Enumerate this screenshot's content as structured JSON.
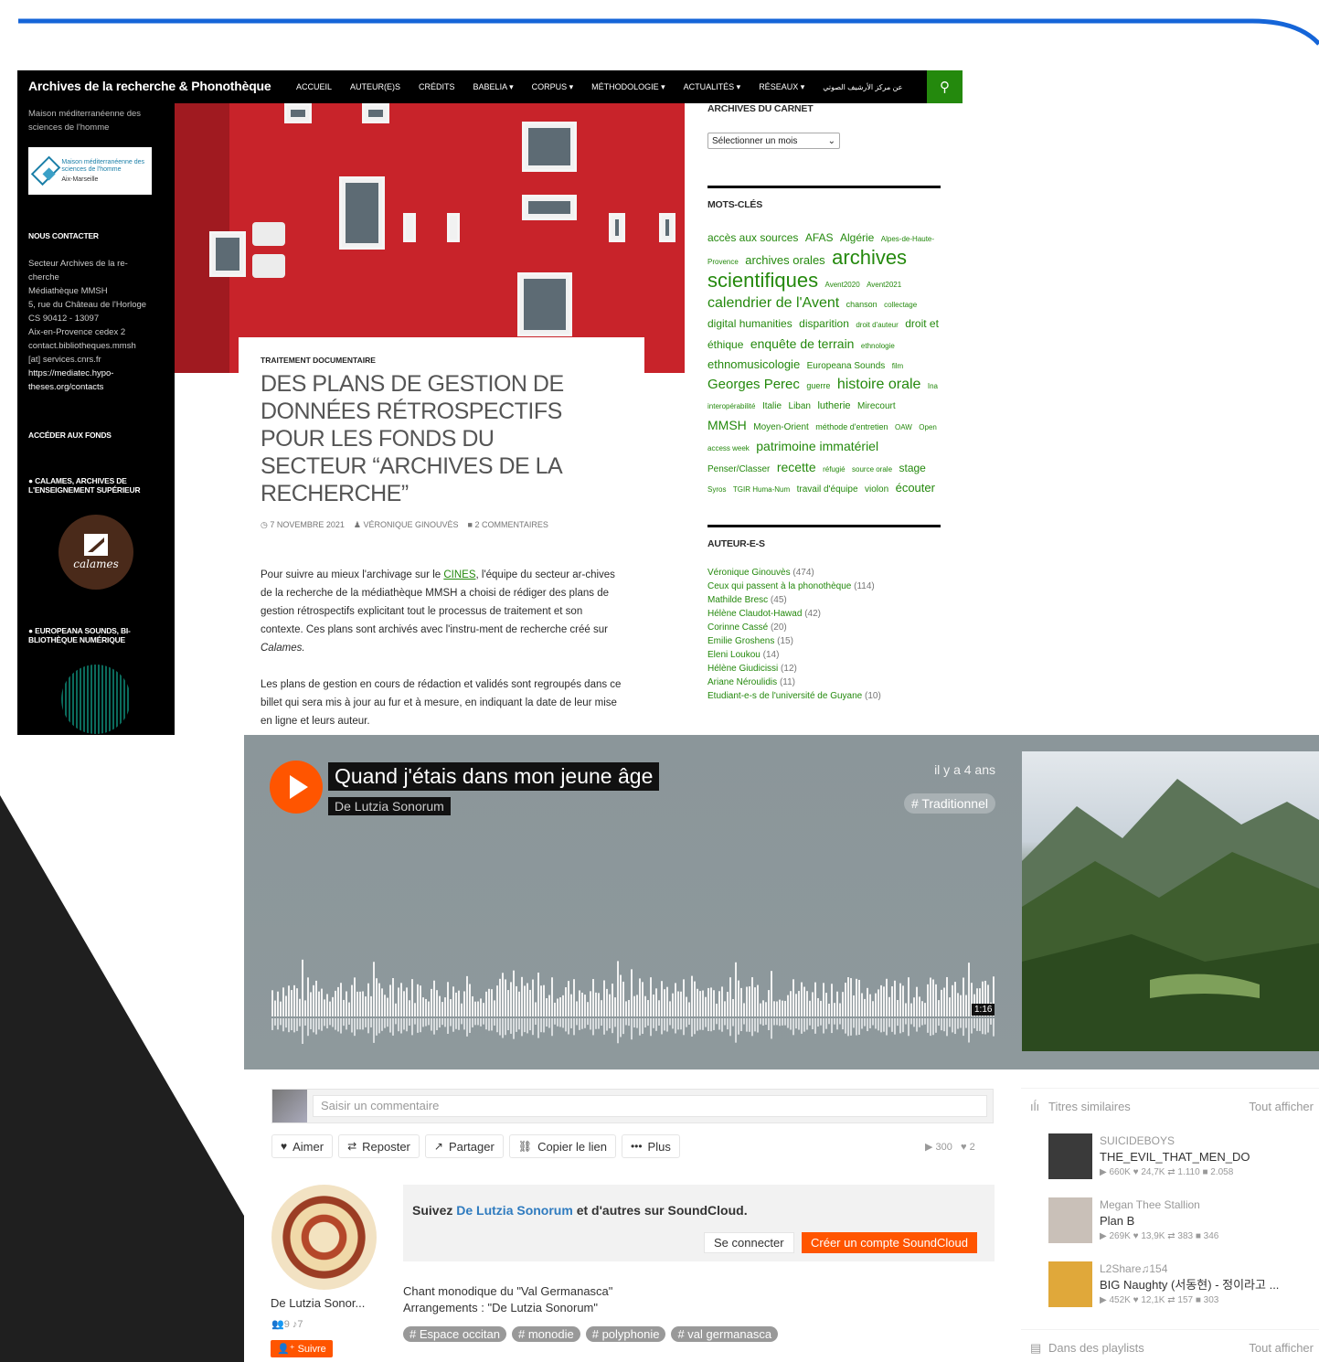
{
  "blog": {
    "site_title": "Archives de la recherche & Phonothèque",
    "menu": [
      "ACCUEIL",
      "AUTEUR(E)S",
      "CRÉDITS",
      "BABELIA ▾",
      "CORPUS ▾",
      "MÉTHODOLOGIE ▾",
      "ACTUALITÉS ▾",
      "RÉSEAUX ▾"
    ],
    "menu_arabic": "عن مركز الأرشيف الصوتي",
    "sidebar": {
      "description": "Maison méditerranéenne des sciences de l'homme",
      "logo_text": "Maison méditerranéenne des sciences de l'homme",
      "logo_sub": "Aix-Marseille",
      "contact_heading": "NOUS CONTACTER",
      "contact_lines": [
        "Secteur Archives de la re-",
        "cherche",
        "Médiathèque MMSH",
        "5, rue du Château de l'Horloge",
        "CS 90412 - 13097",
        "Aix-en-Provence cedex 2",
        "contact.bibliotheques.mmsh",
        "[at] services.cnrs.fr"
      ],
      "contact_link": "https://mediatec.hypo-theses.org/contacts",
      "funds_heading": "ACCÉDER AUX FONDS",
      "calames_heading": "● CALAMES, ARCHIVES DE L'ENSEIGNEMENT SUPÉRIEUR",
      "calames_logo": "calames",
      "europeana_heading": "● EUROPEANA SOUNDS, BI-BLIOTHÈQUE NUMÉRIQUE"
    },
    "post": {
      "category": "TRAITEMENT DOCUMENTAIRE",
      "title": "DES PLANS DE GESTION DE DONNÉES RÉTROSPECTIFS POUR LES FONDS DU SECTEUR “ARCHIVES DE LA RECHERCHE”",
      "date": "7 NOVEMBRE 2021",
      "author": "VÉRONIQUE GINOUVÈS",
      "comments": "2 COMMENTAIRES",
      "p1_a": "Pour suivre au mieux l'archivage sur le ",
      "p1_link": "CINES",
      "p1_b": ", l'équipe du secteur ar-chives de la recherche de la médiathèque MMSH a choisi de rédiger des plans de gestion rétrospectifs explicitant tout le processus de traitement et son contexte. Ces plans sont archivés avec l'instru-ment de recherche créé sur ",
      "p1_em": "Calames.",
      "p2": "Les plans de gestion en cours de rédaction et validés sont regroupés dans ce billet qui sera mis à jour au fur et à mesure, en indiquant la date de leur mise en ligne et leurs auteur."
    },
    "widgets": {
      "archives_heading": "ARCHIVES DU CARNET",
      "archives_select": "Sélectionner un mois",
      "keywords_heading": "MOTS-CLÉS",
      "tags": [
        {
          "t": "accès aux sources",
          "s": 12
        },
        {
          "t": "AFAS",
          "s": 12
        },
        {
          "t": "Algérie",
          "s": 12
        },
        {
          "t": "Alpes-de-Haute-Provence",
          "s": 8
        },
        {
          "t": "archives orales",
          "s": 13
        },
        {
          "t": "archives scientifiques",
          "s": 22
        },
        {
          "t": "Avent2020",
          "s": 8
        },
        {
          "t": "Avent2021",
          "s": 8
        },
        {
          "t": "calendrier de l'Avent",
          "s": 16
        },
        {
          "t": "chanson",
          "s": 9
        },
        {
          "t": "collectage",
          "s": 8
        },
        {
          "t": "digital humanities",
          "s": 12
        },
        {
          "t": "disparition",
          "s": 12
        },
        {
          "t": "droit d'auteur",
          "s": 8
        },
        {
          "t": "droit et éthique",
          "s": 12
        },
        {
          "t": "enquête de terrain",
          "s": 14
        },
        {
          "t": "ethnologie",
          "s": 8
        },
        {
          "t": "ethnomusicologie",
          "s": 13
        },
        {
          "t": "Europeana Sounds",
          "s": 10
        },
        {
          "t": "film",
          "s": 8
        },
        {
          "t": "Georges Perec",
          "s": 15
        },
        {
          "t": "guerre",
          "s": 9
        },
        {
          "t": "histoire orale",
          "s": 16
        },
        {
          "t": "Ina",
          "s": 8
        },
        {
          "t": "interopérabilité",
          "s": 8
        },
        {
          "t": "Italie",
          "s": 10
        },
        {
          "t": "Liban",
          "s": 10
        },
        {
          "t": "lutherie",
          "s": 11
        },
        {
          "t": "Mirecourt",
          "s": 10
        },
        {
          "t": "MMSH",
          "s": 14
        },
        {
          "t": "Moyen-Orient",
          "s": 10
        },
        {
          "t": "méthode d'entretien",
          "s": 9
        },
        {
          "t": "OAW",
          "s": 8
        },
        {
          "t": "Open access week",
          "s": 8
        },
        {
          "t": "patrimoine immatériel",
          "s": 14
        },
        {
          "t": "Penser/Classer",
          "s": 10
        },
        {
          "t": "recette",
          "s": 14
        },
        {
          "t": "réfugié",
          "s": 8
        },
        {
          "t": "source orale",
          "s": 8
        },
        {
          "t": "stage",
          "s": 12
        },
        {
          "t": "Syros",
          "s": 8
        },
        {
          "t": "TGIR Huma-Num",
          "s": 8
        },
        {
          "t": "travail d'équipe",
          "s": 10
        },
        {
          "t": "violon",
          "s": 10
        },
        {
          "t": "écouter",
          "s": 13
        }
      ],
      "authors_heading": "AUTEUR-E-S",
      "authors": [
        {
          "n": "Véronique Ginouvès",
          "c": "(474)"
        },
        {
          "n": "Ceux qui passent à la phonothèque",
          "c": "(114)"
        },
        {
          "n": "Mathilde Bresc",
          "c": "(45)"
        },
        {
          "n": "Hélène Claudot-Hawad",
          "c": "(42)"
        },
        {
          "n": "Corinne Cassé",
          "c": "(20)"
        },
        {
          "n": "Emilie Groshens",
          "c": "(15)"
        },
        {
          "n": "Eleni Loukou",
          "c": "(14)"
        },
        {
          "n": "Hélène Giudicissi",
          "c": "(12)"
        },
        {
          "n": "Ariane Néroulidis",
          "c": "(11)"
        },
        {
          "n": "Etudiant-e-s de l'université de Guyane",
          "c": "(10)"
        }
      ]
    }
  },
  "soundcloud": {
    "title": "Quand j'étais dans mon jeune âge",
    "artist": "De Lutzia Sonorum",
    "ago": "il y a 4 ans",
    "genre": "# Traditionnel",
    "duration": "1:16",
    "comment_placeholder": "Saisir un commentaire",
    "actions": [
      {
        "icon": "♥",
        "label": "Aimer"
      },
      {
        "icon": "⇄",
        "label": "Reposter"
      },
      {
        "icon": "↗",
        "label": "Partager"
      },
      {
        "icon": "⛓",
        "label": "Copier le lien"
      },
      {
        "icon": "•••",
        "label": "Plus"
      }
    ],
    "plays": "▶ 300",
    "likes": "♥ 2",
    "user_name": "De Lutzia Sonor...",
    "user_stats": "👥9  ♪7",
    "follow_label": "Suivre",
    "promo_prefix": "Suivez ",
    "promo_link": "De Lutzia Sonorum",
    "promo_suffix": " et d'autres sur SoundCloud.",
    "login": "Se connecter",
    "signup": "Créer un compte SoundCloud",
    "desc_lines": [
      "Chant monodique du \"Val Germanasca\"",
      "Arrangements : \"De Lutzia Sonorum\""
    ],
    "tags": [
      "# Espace occitan",
      "# monodie",
      "# polyphonie",
      "# val germanasca"
    ],
    "related_heading": "Titres similaires",
    "see_all": "Tout afficher",
    "related": [
      {
        "artist": "SUICIDEBOYS",
        "title": "THE_EVIL_THAT_MEN_DO",
        "stats": "▶ 660K   ♥ 24,7K   ⇄ 1.110   ■ 2.058",
        "color": "#3a3a3a"
      },
      {
        "artist": "Megan Thee Stallion",
        "title": "Plan B",
        "stats": "▶ 269K   ♥ 13,9K   ⇄ 383   ■ 346",
        "color": "#c9c0b8"
      },
      {
        "artist": "L2Share♫154",
        "title": "BIG Naughty (서동현) - 정이라고 ...",
        "stats": "▶ 452K   ♥ 12,1K   ⇄ 157   ■ 303",
        "color": "#e0a83a"
      }
    ],
    "playlists_heading": "Dans des playlists"
  }
}
